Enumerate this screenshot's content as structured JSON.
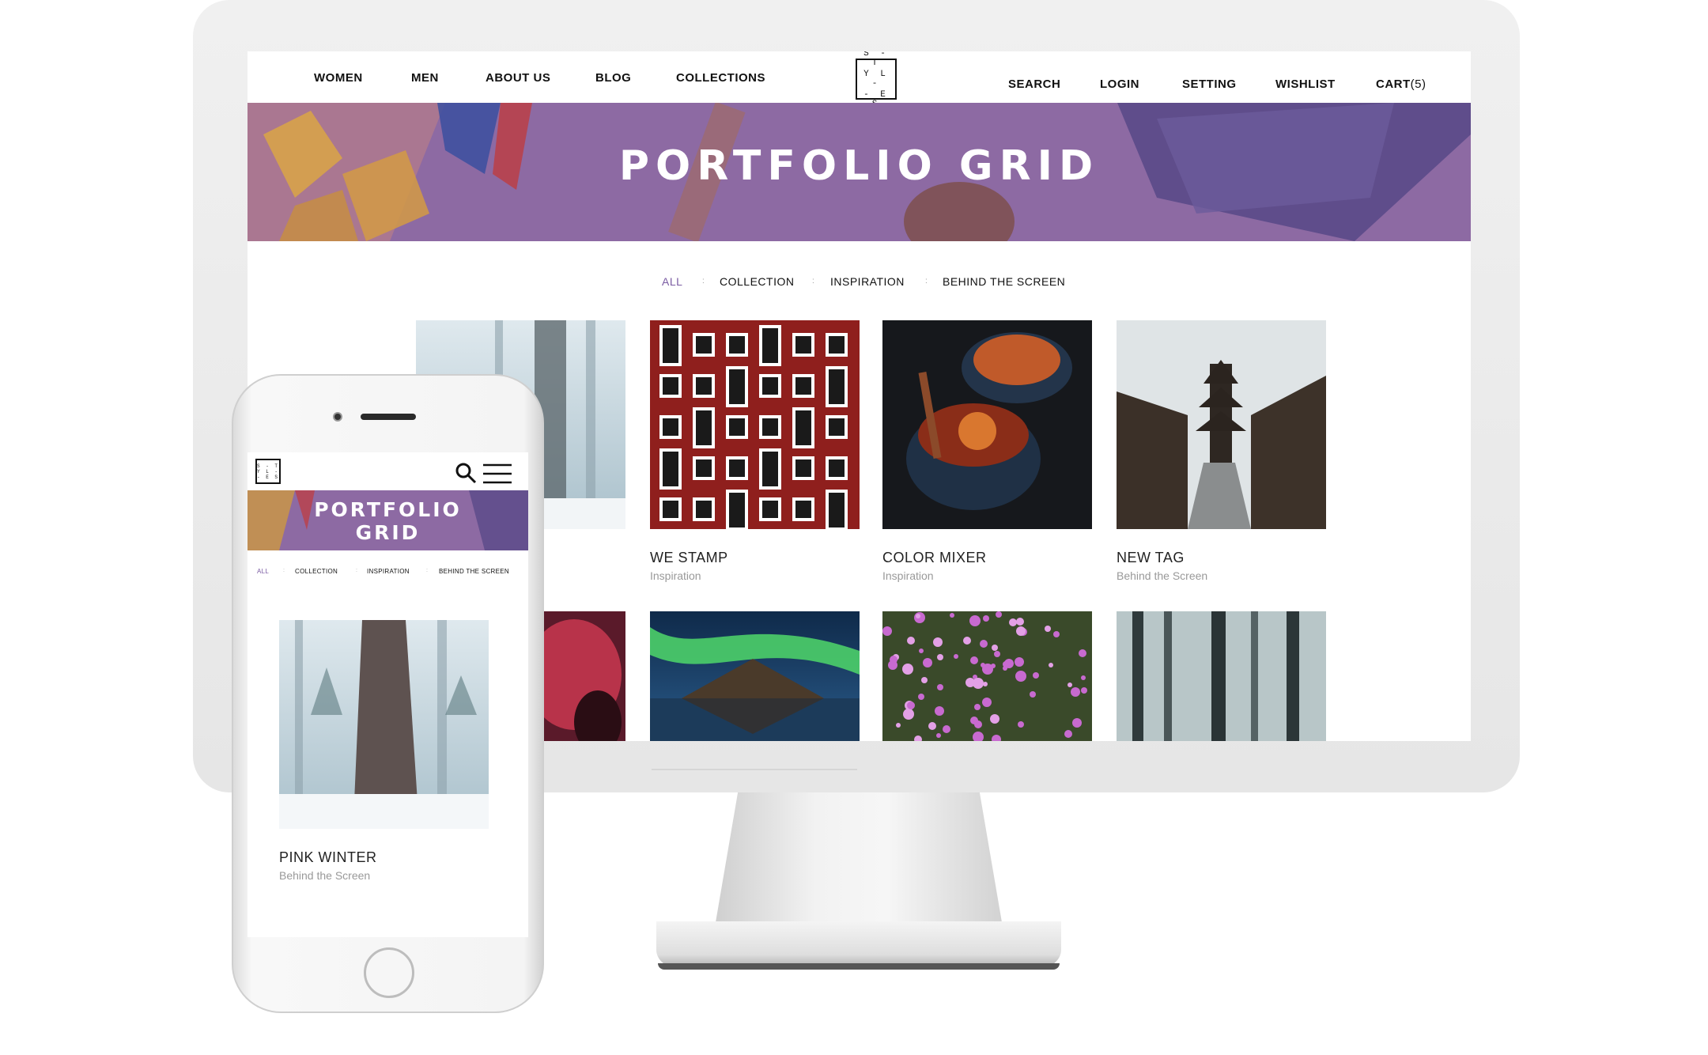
{
  "desktop": {
    "nav_left": [
      "WOMEN",
      "MEN",
      "ABOUT US",
      "BLOG",
      "COLLECTIONS"
    ],
    "logo_lines": [
      "S - T",
      "Y L -",
      "- E S"
    ],
    "nav_right": [
      "SEARCH",
      "LOGIN",
      "SETTING",
      "WISHLIST",
      "CART"
    ],
    "cart_count": "(5)",
    "hero_title": "PORTFOLIO GRID",
    "filters": [
      "ALL",
      "COLLECTION",
      "INSPIRATION",
      "BEHIND THE SCREEN"
    ],
    "filter_separator": ":",
    "grid": [
      {
        "title": "WE STAMP",
        "subtitle": "Inspiration"
      },
      {
        "title": "COLOR MIXER",
        "subtitle": "Inspiration"
      },
      {
        "title": "NEW TAG",
        "subtitle": "Behind the Screen"
      }
    ]
  },
  "mobile": {
    "logo_lines": [
      "S - T",
      "Y L -",
      "- E S"
    ],
    "hero_title_line1": "PORTFOLIO",
    "hero_title_line2": "GRID",
    "filters": [
      "ALL",
      "COLLECTION",
      "INSPIRATION",
      "BEHIND THE SCREEN"
    ],
    "filter_separator": ":",
    "item": {
      "title": "PINK WINTER",
      "subtitle": "Behind the Screen"
    }
  },
  "colors": {
    "accent": "#8e6aa5",
    "filter_active": "#7b5ca3"
  }
}
